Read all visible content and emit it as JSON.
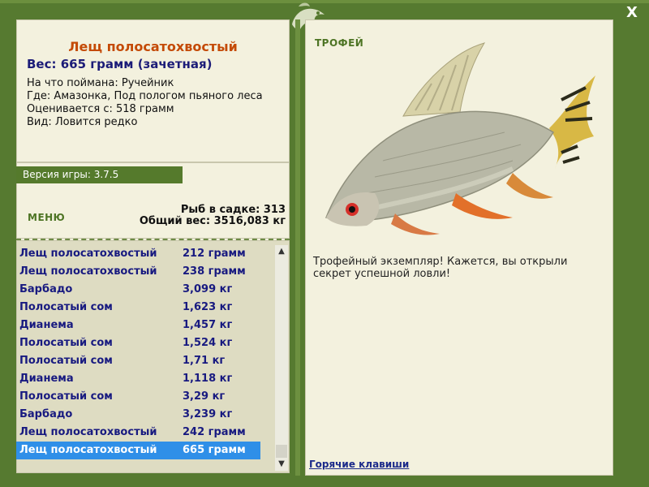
{
  "fish": {
    "name": "Лещ полосатохвостый",
    "weight_line": "Вес: 665 грамм (зачетная)",
    "caught_on": "На что поймана: Ручейник",
    "location": "Где: Амазонка, Под пологом пьяного леса",
    "rated_from": "Оценивается с: 518 грамм",
    "kind": "Вид: Ловится редко"
  },
  "version": "Версия игры: 3.7.5",
  "menu_label": "МЕНЮ",
  "stats": {
    "fish_in_keepnet": "Рыб в садке: 313",
    "total_weight": "Общий вес: 3516,083 кг"
  },
  "catch_list": [
    {
      "name": "Лещ полосатохвостый",
      "weight": "212 грамм"
    },
    {
      "name": "Лещ полосатохвостый",
      "weight": "238 грамм"
    },
    {
      "name": "Барбадо",
      "weight": "3,099 кг"
    },
    {
      "name": "Полосатый сом",
      "weight": "1,623 кг"
    },
    {
      "name": "Дианема",
      "weight": "1,457 кг"
    },
    {
      "name": "Полосатый сом",
      "weight": "1,524 кг"
    },
    {
      "name": "Полосатый сом",
      "weight": "1,71 кг"
    },
    {
      "name": "Дианема",
      "weight": "1,118 кг"
    },
    {
      "name": "Полосатый сом",
      "weight": "3,29 кг"
    },
    {
      "name": "Барбадо",
      "weight": "3,239 кг"
    },
    {
      "name": "Лещ полосатохвостый",
      "weight": "242 грамм"
    },
    {
      "name": "Лещ полосатохвостый",
      "weight": "665 грамм"
    }
  ],
  "selected_index": 11,
  "trophy_label": "ТРОФЕЙ",
  "trophy_text": "Трофейный экземпляр! Кажется, вы открыли секрет успешной ловли!",
  "hotkeys_link": "Горячие клавиши",
  "close_label": "X",
  "colors": {
    "accent_green": "#567a30",
    "title_orange": "#c44a06",
    "list_blue": "#181a80",
    "selection": "#2f8fe8"
  }
}
